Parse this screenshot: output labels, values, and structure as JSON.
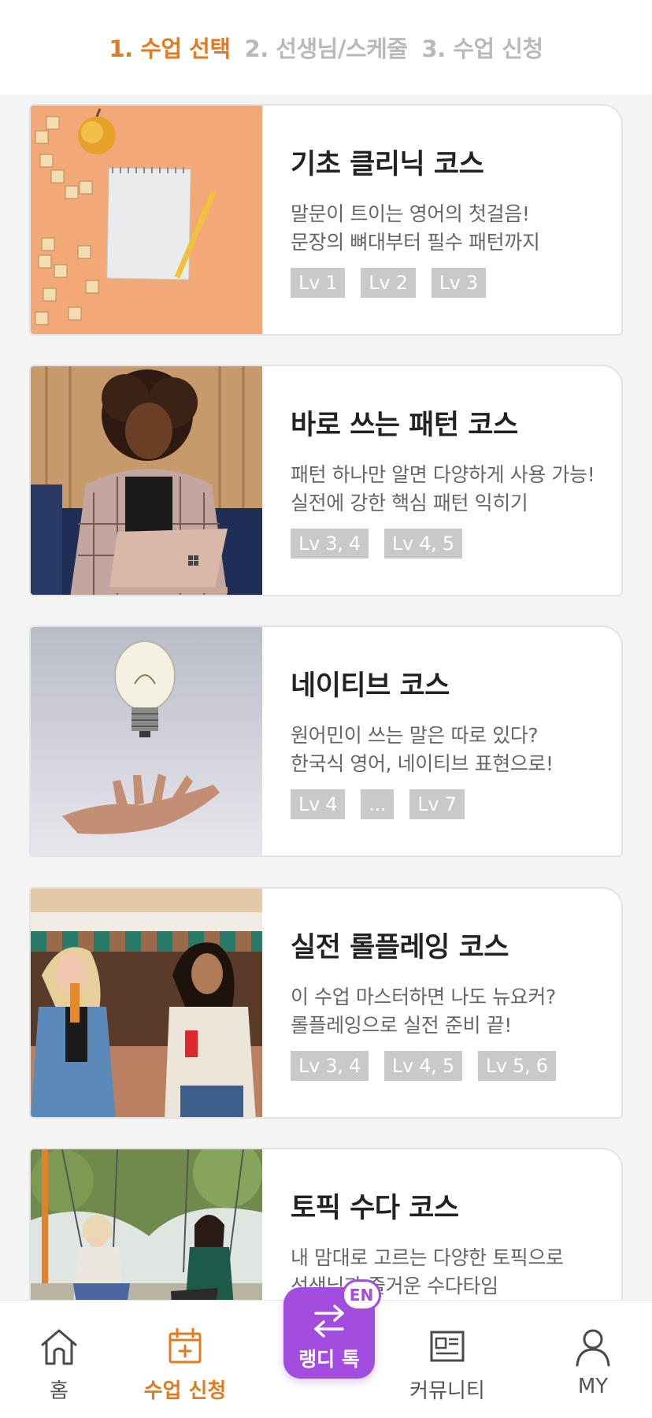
{
  "steps": [
    "1. 수업 선택",
    "2. 선생님/스케줄",
    "3. 수업 신청"
  ],
  "active_step": 0,
  "courses": [
    {
      "title": "기초 클리닉 코스",
      "desc": [
        "말문이 트이는 영어의 첫걸음!",
        "문장의 뼈대부터 필수 패턴까지"
      ],
      "levels": [
        "Lv 1",
        "Lv 2",
        "Lv 3"
      ],
      "image": "apple-notepad-letter-tiles"
    },
    {
      "title": "바로 쓰는 패턴 코스",
      "desc": [
        "패턴 하나만 알면 다양하게 사용 가능!",
        "실전에 강한 핵심 패턴 익히기"
      ],
      "levels": [
        "Lv 3, 4",
        "Lv 4, 5"
      ],
      "image": "woman-with-laptop"
    },
    {
      "title": "네이티브 코스",
      "desc": [
        "원어민이 쓰는 말은 따로 있다?",
        "한국식 영어, 네이티브 표현으로!"
      ],
      "levels": [
        "Lv 4",
        "...",
        "Lv 7"
      ],
      "image": "lightbulb-over-hand"
    },
    {
      "title": "실전 롤플레잉 코스",
      "desc": [
        "이 수업 마스터하면 나도 뉴요커?",
        "롤플레잉으로 실전 준비 끝!"
      ],
      "levels": [
        "Lv 3, 4",
        "Lv 4, 5",
        "Lv 5, 6"
      ],
      "image": "two-women-street"
    },
    {
      "title": "토픽 수다 코스",
      "desc": [
        "내 맘대로 고르는 다양한 토픽으로",
        "선생님과 즐거운 수다타임"
      ],
      "levels": [],
      "image": "women-on-swings"
    }
  ],
  "bottom_nav": {
    "home": {
      "label": "홈",
      "icon": "home-icon"
    },
    "lesson": {
      "label": "수업 신청",
      "icon": "calendar-add-icon"
    },
    "center": {
      "label": "랭디 톡",
      "icon": "swap-arrows-icon",
      "badge": "EN"
    },
    "community": {
      "label": "커뮤니티",
      "icon": "newspaper-icon"
    },
    "my": {
      "label": "MY",
      "icon": "person-icon"
    }
  },
  "colors": {
    "accent": "#e27a1f",
    "purple": "#a24de0",
    "level_badge": "#c9c9cb",
    "inactive_step": "#b9b9bb"
  }
}
